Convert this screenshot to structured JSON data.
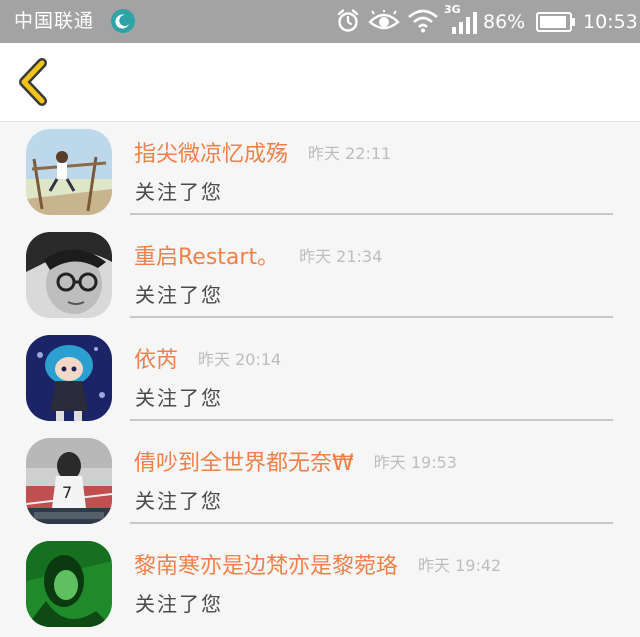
{
  "status_bar": {
    "carrier": "中国联通",
    "network": "3G",
    "battery_percent": "86%",
    "time": "10:53",
    "icons": [
      "moon-app-icon",
      "alarm-icon",
      "eye-icon",
      "wifi-icon",
      "signal-icon",
      "battery-icon"
    ]
  },
  "header": {
    "back_icon": "chevron-left-icon",
    "accent_color": "#f0c419"
  },
  "list": {
    "items": [
      {
        "name": "指尖微凉忆成殇",
        "time": "昨天 22:11",
        "action": "关注了您",
        "avatar": "avatar-boy-on-swing"
      },
      {
        "name": "重启Restart。",
        "time": "昨天 21:34",
        "action": "关注了您",
        "avatar": "avatar-man-glasses-bw"
      },
      {
        "name": "依芮",
        "time": "昨天 20:14",
        "action": "关注了您",
        "avatar": "avatar-anime-girl"
      },
      {
        "name": "倩吵到全世界都无奈₩",
        "time": "昨天 19:53",
        "action": "关注了您",
        "avatar": "avatar-girl-jersey-7"
      },
      {
        "name": "黎南寒亦是边梵亦是黎菀珞",
        "time": "昨天 19:42",
        "action": "关注了您",
        "avatar": "avatar-girl-green"
      }
    ]
  },
  "colors": {
    "name": "#f0804a",
    "time": "#bdbdbd",
    "status_bar_bg": "#a3a3a3"
  }
}
